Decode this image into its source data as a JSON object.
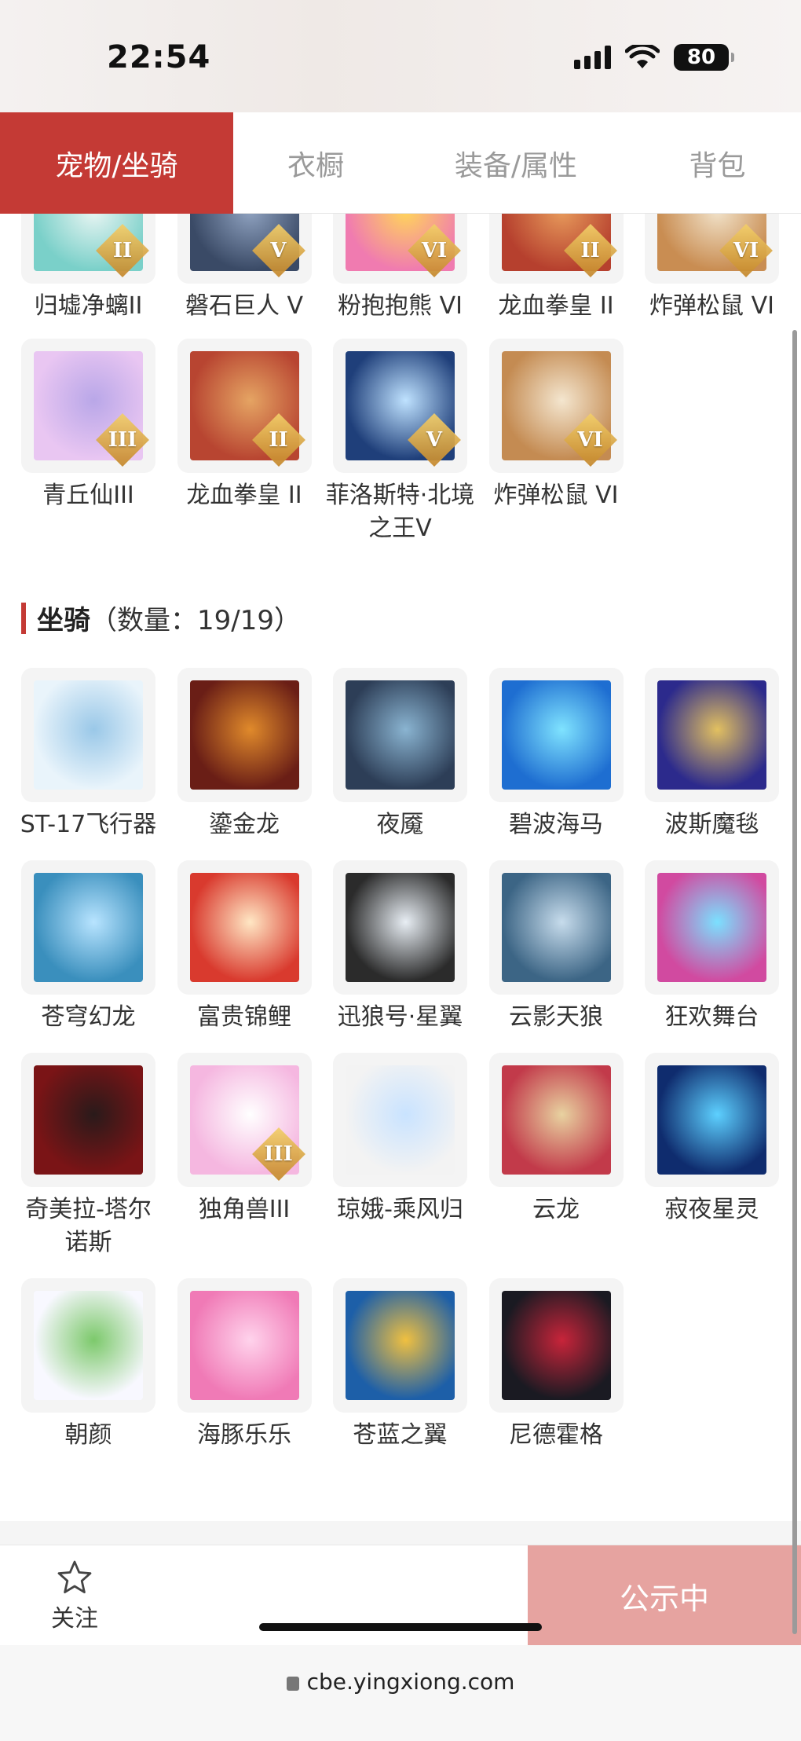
{
  "status": {
    "time": "22:54",
    "battery": "80"
  },
  "tabs": [
    {
      "label": "宠物/坐骑",
      "active": true
    },
    {
      "label": "衣橱"
    },
    {
      "label": "装备/属性"
    },
    {
      "label": "背包"
    }
  ],
  "pets": [
    {
      "name": "归墟净螭II",
      "tier": "II",
      "colors": [
        "#7ad0c9",
        "#e9f5f3"
      ]
    },
    {
      "name": "磐石巨人 V",
      "tier": "V",
      "colors": [
        "#3a4a66",
        "#8fa2c0"
      ]
    },
    {
      "name": "粉抱抱熊 VI",
      "tier": "VI",
      "colors": [
        "#f07bb0",
        "#ffd55a"
      ]
    },
    {
      "name": "龙血拳皇 II",
      "tier": "II",
      "colors": [
        "#b6402e",
        "#e79a5b"
      ]
    },
    {
      "name": "炸弹松鼠 VI",
      "tier": "VI",
      "colors": [
        "#c98d52",
        "#f1e2c9"
      ]
    },
    {
      "name": "青丘仙III",
      "tier": "III",
      "colors": [
        "#e9c6f2",
        "#b9a7e8"
      ]
    },
    {
      "name": "龙血拳皇 II",
      "tier": "II",
      "colors": [
        "#b84531",
        "#e5a463"
      ]
    },
    {
      "name": "菲洛斯特·北境之王V",
      "tier": "V",
      "colors": [
        "#1f3f7a",
        "#bfe2ff"
      ]
    },
    {
      "name": "炸弹松鼠 VI",
      "tier": "VI",
      "colors": [
        "#c48b52",
        "#f4e6cf"
      ]
    }
  ],
  "mounts_section": {
    "title": "坐骑",
    "count": "（数量：19/19）"
  },
  "mounts": [
    {
      "name": "ST-17飞行器",
      "colors": [
        "#e9f4fb",
        "#9ac8e8"
      ]
    },
    {
      "name": "鎏金龙",
      "colors": [
        "#6a1e16",
        "#e08a2b"
      ]
    },
    {
      "name": "夜魇",
      "colors": [
        "#2d3e57",
        "#8ab4d1"
      ]
    },
    {
      "name": "碧波海马",
      "colors": [
        "#1e6ed1",
        "#7fe3ff"
      ]
    },
    {
      "name": "波斯魔毯",
      "colors": [
        "#2c2a8c",
        "#e2c060"
      ]
    },
    {
      "name": "苍穹幻龙",
      "colors": [
        "#3a8fbd",
        "#b8e4ff"
      ]
    },
    {
      "name": "富贵锦鲤",
      "colors": [
        "#d93a2e",
        "#ffe7c4"
      ]
    },
    {
      "name": "迅狼号·星翼",
      "colors": [
        "#2b2b2b",
        "#e8eef4"
      ]
    },
    {
      "name": "云影天狼",
      "colors": [
        "#3c6585",
        "#c7dcec"
      ]
    },
    {
      "name": "狂欢舞台",
      "colors": [
        "#d14aa0",
        "#7be0ff"
      ]
    },
    {
      "name": "奇美拉-塔尔诺斯",
      "colors": [
        "#7a1416",
        "#2a1a1a"
      ]
    },
    {
      "name": "独角兽III",
      "tier": "III",
      "colors": [
        "#f5b7e0",
        "#ffffff"
      ]
    },
    {
      "name": "琼娥-乘风归",
      "colors": [
        "#f3f3f3",
        "#c9e3ff"
      ]
    },
    {
      "name": "云龙",
      "colors": [
        "#c23a4a",
        "#e8d2a0"
      ]
    },
    {
      "name": "寂夜星灵",
      "colors": [
        "#0f2c6e",
        "#5dd0ff"
      ]
    },
    {
      "name": "朝颜",
      "colors": [
        "#f8f8ff",
        "#7cc96b"
      ]
    },
    {
      "name": "海豚乐乐",
      "colors": [
        "#f07ab6",
        "#ffd3ec"
      ]
    },
    {
      "name": "苍蓝之翼",
      "colors": [
        "#1d5fa8",
        "#f0c040"
      ]
    },
    {
      "name": "尼德霍格",
      "colors": [
        "#1a1a22",
        "#c8243a"
      ]
    }
  ],
  "footer": {
    "follow_label": "关注",
    "cta_label": "公示中"
  },
  "browser": {
    "url": "cbe.yingxiong.com"
  },
  "theme": {
    "accent": "#c43a35",
    "cta_bg": "#e6a3a0"
  }
}
